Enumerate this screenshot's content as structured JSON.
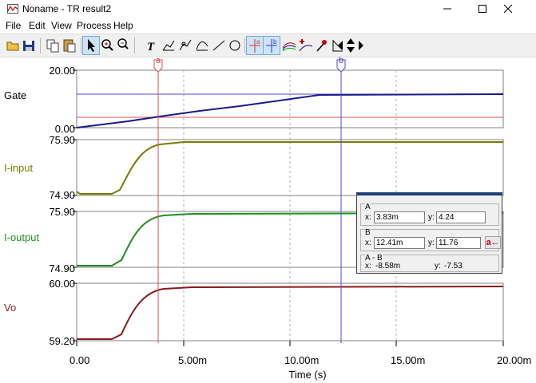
{
  "window": {
    "title": "Noname - TR result2"
  },
  "menu": [
    "File",
    "Edit",
    "View",
    "Process",
    "Help"
  ],
  "toolbar": {
    "icons": [
      "open-icon",
      "save-icon",
      "copy-icon",
      "paste-icon",
      "select-pointer-icon",
      "zoom-in-icon",
      "zoom-100-icon",
      "text-icon",
      "marker-icon",
      "line-marker-icon",
      "curve-icon",
      "line-icon",
      "circle-icon",
      "cursor-a-icon",
      "cursor-b-icon",
      "curves-icon",
      "add-point-icon",
      "pin-icon",
      "arrow-icon",
      "left-icon",
      "up-down-icon",
      "right-icon"
    ]
  },
  "panels": [
    {
      "label": "Gate",
      "color": "#000000",
      "ymax": "20.00",
      "ymin": "0.00"
    },
    {
      "label": "I-input",
      "color": "#7a7a00",
      "ymax": "75.90",
      "ymin": "74.90"
    },
    {
      "label": "I-output",
      "color": "#1f8f1f",
      "ymax": "75.90",
      "ymin": "74.90"
    },
    {
      "label": "Vo",
      "color": "#8b1a1a",
      "ymax": "60.00",
      "ymin": "59.20"
    }
  ],
  "x_ticks": [
    "0.00",
    "5.00m",
    "10.00m",
    "15.00m",
    "20.00m"
  ],
  "x_label": "Time (s)",
  "cursors": {
    "a_label": "a",
    "b_label": "b",
    "a_color": "#e05050",
    "b_color": "#4a4ad8"
  },
  "cursor_window": {
    "group_a": "A",
    "group_b": "B",
    "group_diff": "A - B",
    "x_label": "x:",
    "y_label": "y:",
    "a_x": "3.83m",
    "a_y": "4.24",
    "b_x": "12.41m",
    "b_y": "11.76",
    "diff_x": "-8.58m",
    "diff_y": "-7.53",
    "swap_label": "a←"
  },
  "colors": {
    "gate_trace": "#1a1a8c",
    "i_input": "#7a7a00",
    "i_output": "#1f8f1f",
    "vo": "#8b1a1a",
    "red_line": "#e05050",
    "blue_line": "#4a4ad8"
  }
}
